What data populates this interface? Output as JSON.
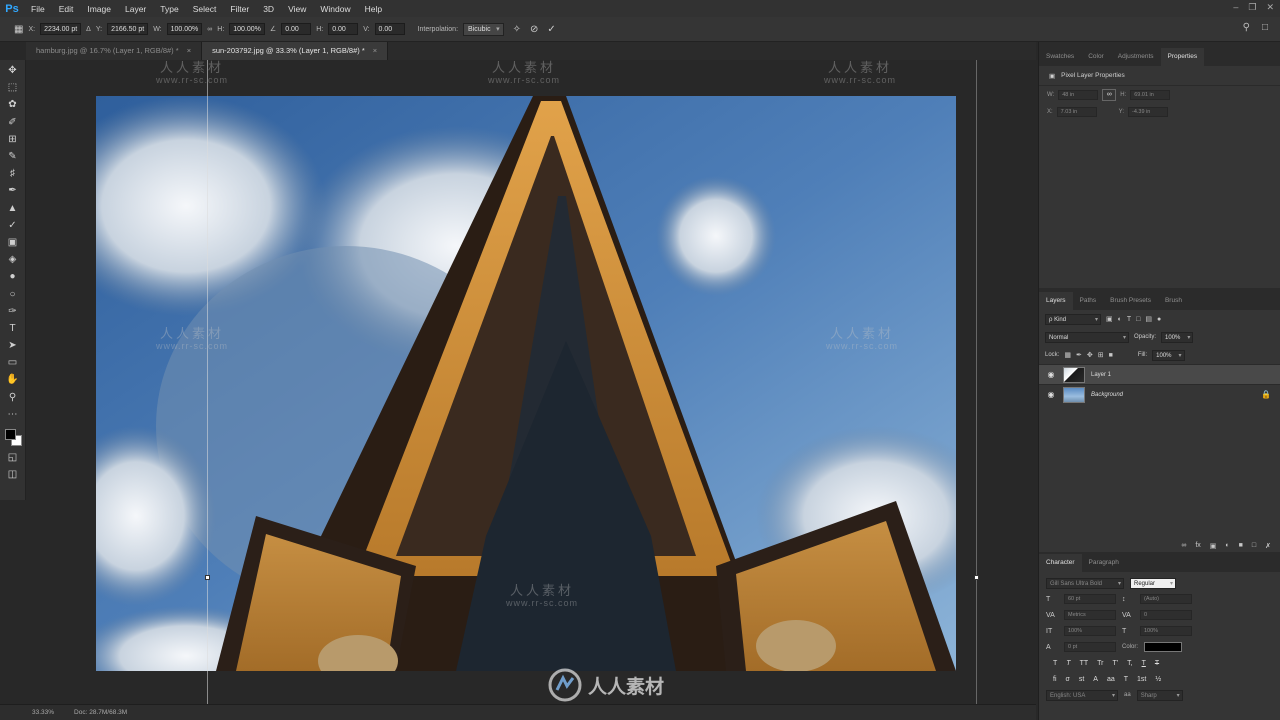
{
  "app": {
    "logo": "Ps"
  },
  "menu": [
    "File",
    "Edit",
    "Image",
    "Layer",
    "Type",
    "Select",
    "Filter",
    "3D",
    "View",
    "Window",
    "Help"
  ],
  "window_controls": {
    "minimize": "–",
    "restore": "❐",
    "close": "✕"
  },
  "options_bar": {
    "x_label": "X:",
    "x_value": "2234.00 pt",
    "y_label": "Y:",
    "y_value": "2166.50 pt",
    "w_label": "W:",
    "w_value": "100.00%",
    "h_label": "H:",
    "h_value": "100.00%",
    "angle_value": "0.00",
    "hskew_label": "H:",
    "hskew_value": "0.00",
    "vskew_label": "V:",
    "vskew_value": "0.00",
    "interp_label": "Interpolation:",
    "interp_value": "Bicubic"
  },
  "tabs": [
    {
      "label": "hamburg.jpg @ 16.7% (Layer 1, RGB/8#) *",
      "close": "×",
      "active": false
    },
    {
      "label": "sun-203792.jpg @ 33.3% (Layer 1, RGB/8#) *",
      "close": "×",
      "active": true
    }
  ],
  "status": {
    "zoom": "33.33%",
    "doc": "Doc: 28.7M/68.3M"
  },
  "panels": {
    "top_tabs": [
      "Swatches",
      "Color",
      "Adjustments",
      "Properties"
    ],
    "properties": {
      "title": "Pixel Layer Properties",
      "w_label": "W:",
      "w_value": "48 in",
      "h_label": "H:",
      "h_value": "69.01 in",
      "x_label": "X:",
      "x_value": "7.03 in",
      "y_label": "Y:",
      "y_value": "-4.39 in",
      "link_icon": "∞"
    },
    "layers_tabs": [
      "Layers",
      "Paths",
      "Brush Presets",
      "Brush"
    ],
    "layers": {
      "kind_label": "ρ Kind",
      "blend_mode": "Normal",
      "opacity_label": "Opacity:",
      "opacity_value": "100%",
      "lock_label": "Lock:",
      "fill_label": "Fill:",
      "fill_value": "100%",
      "items": [
        {
          "name": "Layer 1",
          "selected": true
        },
        {
          "name": "Background",
          "selected": false,
          "locked": true
        }
      ]
    },
    "char_tabs": [
      "Character",
      "Paragraph"
    ],
    "character": {
      "font_family": "Gill Sans Ultra Bold",
      "font_style": "Regular",
      "size": "60 pt",
      "leading": "(Auto)",
      "kerning": "Metrics",
      "tracking": "0",
      "vscale": "100%",
      "hscale": "100%",
      "baseline": "0 pt",
      "color_label": "Color:",
      "language": "English: USA",
      "antialias": "Sharp",
      "style_glyphs": [
        "T",
        "T",
        "TT",
        "Tr",
        "T'",
        "T,",
        "T",
        "T"
      ],
      "ot_glyphs": [
        "fi",
        "σ",
        "st",
        "A",
        "aa",
        "T",
        "1st",
        "½"
      ]
    }
  },
  "watermark": {
    "cn": "人人素材",
    "url": "www.rr-sc.com",
    "logo_text": "人人素材"
  },
  "colors": {
    "accent": "#31a8ff",
    "canvas_bg": "#282828",
    "panel_bg": "#353535"
  }
}
